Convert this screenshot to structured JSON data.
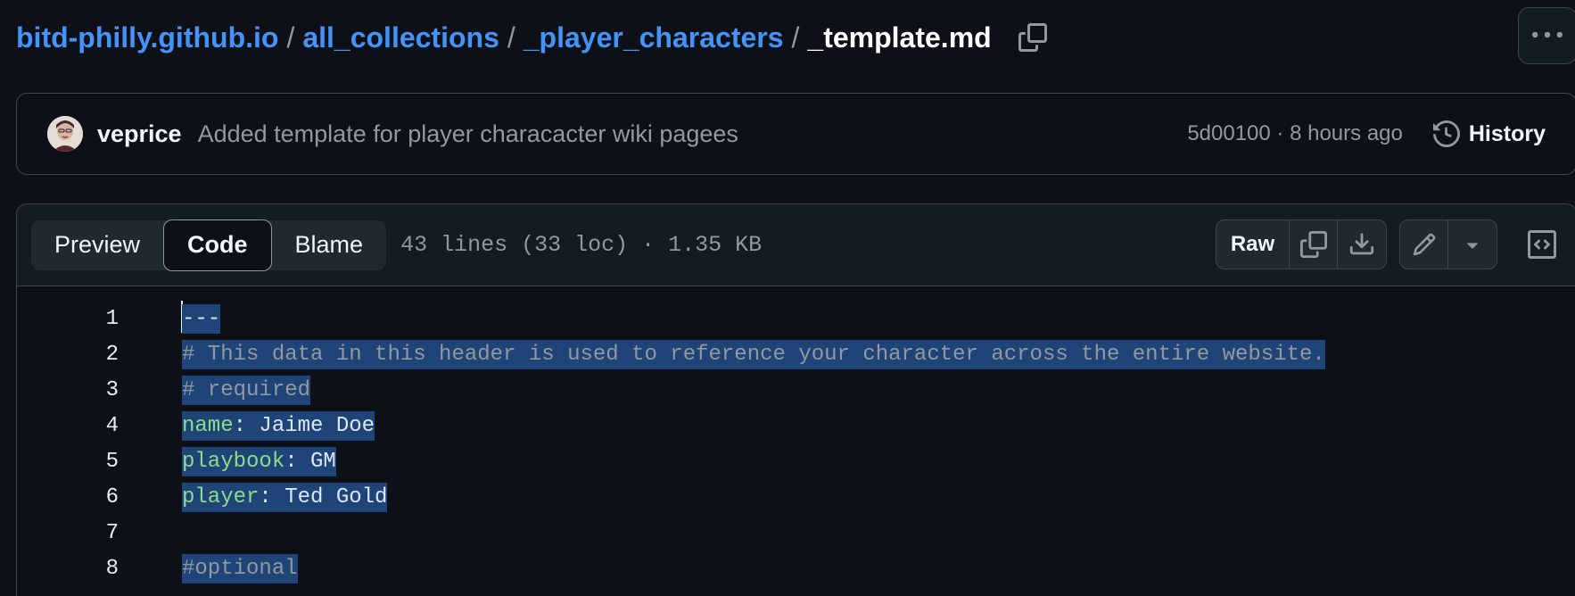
{
  "breadcrumb": {
    "repo": "bitd-philly.github.io",
    "folder1": "all_collections",
    "folder2": "_player_characters",
    "file": "_template.md",
    "separator": "/"
  },
  "commit": {
    "author": "veprice",
    "message": "Added template for player characacter wiki pagees",
    "sha": "5d00100",
    "dot": "·",
    "time": "8 hours ago",
    "history_label": "History"
  },
  "file_header": {
    "tabs": [
      {
        "label": "Preview",
        "active": false
      },
      {
        "label": "Code",
        "active": true
      },
      {
        "label": "Blame",
        "active": false
      }
    ],
    "info": "43 lines (33 loc) · 1.35 KB",
    "raw_label": "Raw"
  },
  "icons": {
    "copy_path": "copy-icon",
    "more": "kebab-horizontal-icon",
    "history": "history-icon",
    "copy": "copy-icon",
    "download": "download-icon",
    "edit": "pencil-icon",
    "dropdown": "triangle-down-icon",
    "symbols": "code-square-icon"
  },
  "colors": {
    "background": "#0d1117",
    "link": "#4493f8",
    "selection": "#1f4477",
    "yaml_key": "#8ddb8c",
    "comment": "#9198a1"
  },
  "code": {
    "lines": [
      {
        "num": "1",
        "tokens": [
          {
            "t": "---",
            "c": "tok-punct"
          }
        ]
      },
      {
        "num": "2",
        "tokens": [
          {
            "t": "# This data in this header is used to reference your character across the entire website.",
            "c": "tok-comment"
          }
        ]
      },
      {
        "num": "3",
        "tokens": [
          {
            "t": "# required",
            "c": "tok-comment"
          }
        ]
      },
      {
        "num": "4",
        "tokens": [
          {
            "t": "name",
            "c": "tok-key"
          },
          {
            "t": ": Jaime Doe",
            "c": "tok-val"
          }
        ]
      },
      {
        "num": "5",
        "tokens": [
          {
            "t": "playbook",
            "c": "tok-key"
          },
          {
            "t": ": GM",
            "c": "tok-val"
          }
        ]
      },
      {
        "num": "6",
        "tokens": [
          {
            "t": "player",
            "c": "tok-key"
          },
          {
            "t": ": Ted Gold",
            "c": "tok-val"
          }
        ]
      },
      {
        "num": "7",
        "tokens": []
      },
      {
        "num": "8",
        "tokens": [
          {
            "t": "#optional",
            "c": "tok-comment"
          }
        ]
      }
    ]
  }
}
